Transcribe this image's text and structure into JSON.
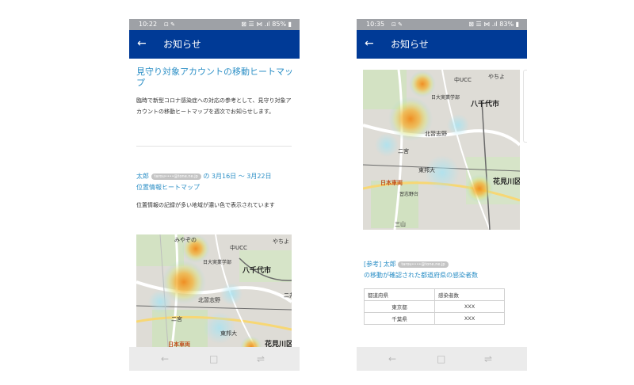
{
  "left_phone": {
    "status": {
      "time": "10:22",
      "icons": "⊡ ✎",
      "right": "⊠ ☰ ⋈ .ıl 85% ▮"
    },
    "appbar": {
      "back": "←",
      "title": "お知らせ"
    },
    "article": {
      "title": "見守り対象アカウントの移動ヒートマップ",
      "body": "臨時で新型コロナ感染症への対応の参考として、見守り対象アカウントの移動ヒートマップを週次でお知らせします。"
    },
    "section": {
      "user": "太郎",
      "email": "tarou••••@tone.ne.jp",
      "date_range": "の 3月16日 〜 3月22日",
      "heading": "位置情報ヒートマップ",
      "desc": "位置情報の記録が多い地域が濃い色で表示されています"
    },
    "map": {
      "labels": [
        "みやぞの",
        "やちよ",
        "中UCC",
        "日大実業学部",
        "八千代市",
        "北習志野",
        "二宮",
        "東邦大",
        "日本車両",
        "花見川区",
        "二井"
      ]
    },
    "navbar": {
      "back": "←",
      "home": "□",
      "recent": "⇌"
    }
  },
  "right_phone": {
    "status": {
      "time": "10:35",
      "icons": "⊡ ✎",
      "right": "⊠ ☰ ⋈ .ıl 83% ▮"
    },
    "appbar": {
      "back": "←",
      "title": "お知らせ"
    },
    "map": {
      "labels": [
        "中UCC",
        "やちよ",
        "日大実業学部",
        "八千代市",
        "北習志野",
        "二宮",
        "東邦大",
        "日本車両",
        "習志野台",
        "花見川区",
        "三山"
      ]
    },
    "ref": {
      "tag": "[参考]",
      "user": "太郎",
      "email": "tarou••••@tone.ne.jp",
      "line2": "の移動が確認された都道府県の感染者数"
    },
    "table": {
      "headers": [
        "都道府県",
        "感染者数"
      ],
      "rows": [
        [
          "東京都",
          "XXX"
        ],
        [
          "千葉県",
          "XXX"
        ]
      ]
    },
    "navbar": {
      "back": "←",
      "home": "□",
      "recent": "⇌"
    }
  },
  "colors": {
    "appbar": "#003a96",
    "status": "#9ea1a6",
    "accent": "#2c8fc6",
    "heat_core": "#f08a1a"
  }
}
